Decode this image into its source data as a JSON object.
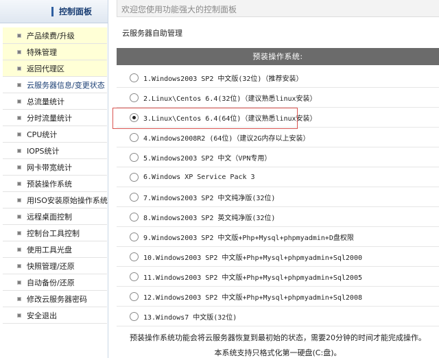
{
  "sidebar": {
    "title": "控制面板",
    "items": [
      {
        "label": "产品续费/升级",
        "hl": true
      },
      {
        "label": "特殊管理",
        "hl": true
      },
      {
        "label": "返回代理区",
        "hl": true
      },
      {
        "label": "云服务器信息/变更状态",
        "active": true
      },
      {
        "label": "总流量统计"
      },
      {
        "label": "分时流量统计"
      },
      {
        "label": "CPU统计"
      },
      {
        "label": "IOPS统计"
      },
      {
        "label": "网卡带宽统计"
      },
      {
        "label": "预装操作系统"
      },
      {
        "label": "用ISO安装原始操作系统"
      },
      {
        "label": "远程桌面控制"
      },
      {
        "label": "控制台工具控制"
      },
      {
        "label": "使用工具光盘"
      },
      {
        "label": "快照管理/还原"
      },
      {
        "label": "自动备份/还原"
      },
      {
        "label": "修改云服务器密码"
      },
      {
        "label": "安全退出"
      }
    ]
  },
  "header": {
    "welcome": "欢迎您使用功能强大的控制面板",
    "section_title": "云服务器自助管理"
  },
  "os": {
    "header": "预装操作系统:",
    "selected_index": 2,
    "options": [
      "1.Windows2003 SP2 中文版(32位)（推荐安装）",
      "2.Linux\\Centos 6.4(32位)（建议熟悉linux安装）",
      "3.Linux\\Centos 6.4(64位)（建议熟悉linux安装）",
      "4.Windows2008R2 (64位)（建议2G内存以上安装）",
      "5.Windows2003 SP2 中文（VPN专用）",
      "6.Windows XP Service Pack 3",
      "7.Windows2003 SP2 中文纯净版(32位)",
      "8.Windows2003 SP2 英文纯净版(32位)",
      "9.Windows2003 SP2 中文版+Php+Mysql+phpmyadmin+D盘权限",
      "10.Windows2003 SP2 中文版+Php+Mysql+phpmyadmin+Sql2000",
      "11.Windows2003 SP2 中文版+Php+Mysql+phpmyadmin+Sql2005",
      "12.Windows2003 SP2 中文版+Php+Mysql+phpmyadmin+Sql2008",
      "13.Windows7 中文版(32位)"
    ],
    "note1": "预装操作系统功能会将云服务器恢复到最初始的状态，需要20分钟的时间才能完成操作。",
    "note2": "本系统支持只格式化第一硬盘(C:盘)。"
  }
}
